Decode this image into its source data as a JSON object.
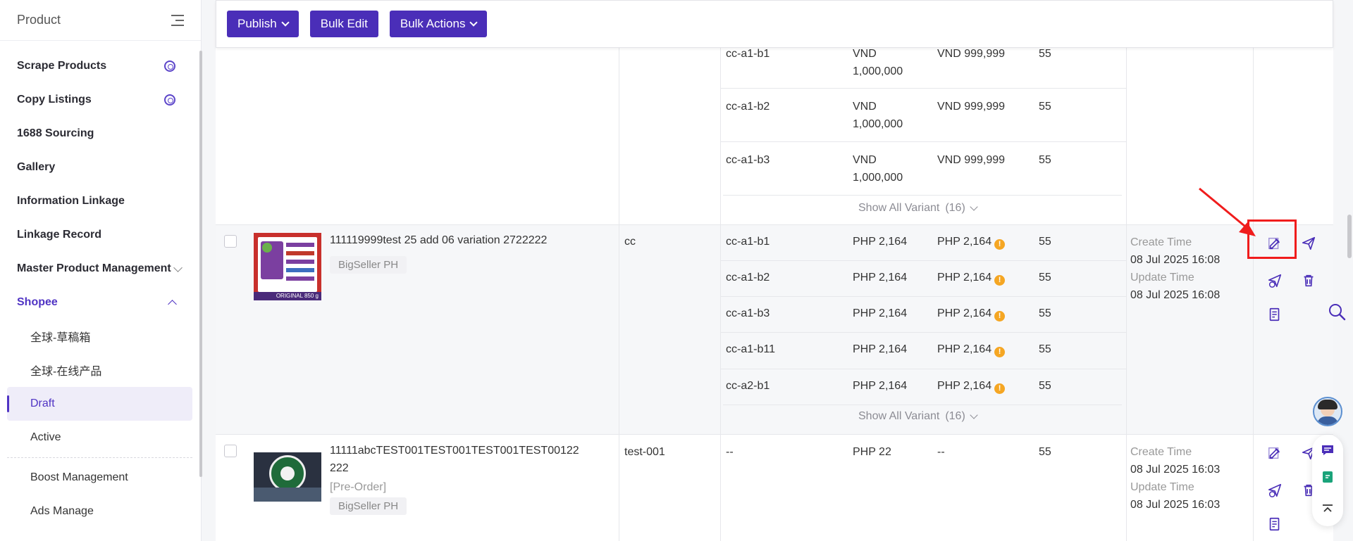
{
  "sidebar": {
    "title": "Product",
    "items": [
      {
        "label": "Scrape Products"
      },
      {
        "label": "Copy Listings"
      },
      {
        "label": "1688 Sourcing"
      },
      {
        "label": "Gallery"
      },
      {
        "label": "Information Linkage"
      },
      {
        "label": "Linkage Record"
      },
      {
        "label": "Master Product Management"
      },
      {
        "label": "Shopee"
      }
    ],
    "sub_items": [
      {
        "label": "全球-草稿箱"
      },
      {
        "label": "全球-在线产品"
      },
      {
        "label": "Draft"
      },
      {
        "label": "Active"
      },
      {
        "label": "Boost Management"
      },
      {
        "label": "Ads Manage"
      }
    ]
  },
  "toolbar": {
    "publish": "Publish",
    "bulk_edit": "Bulk Edit",
    "bulk_actions": "Bulk Actions"
  },
  "prev_product": {
    "variants": [
      {
        "sku": "cc-a1-b1",
        "price1": "VND",
        "price1b": "1,000,000",
        "price2": "VND 999,999",
        "stock": "55"
      },
      {
        "sku": "cc-a1-b2",
        "price1": "VND",
        "price1b": "1,000,000",
        "price2": "VND 999,999",
        "stock": "55"
      },
      {
        "sku": "cc-a1-b3",
        "price1": "VND",
        "price1b": "1,000,000",
        "price2": "VND 999,999",
        "stock": "55"
      }
    ],
    "show_all": "Show All Variant",
    "count": "(16)"
  },
  "product1": {
    "title": "111119999test 25 add 06 variation 2722222",
    "store_tag": "BigSeller PH",
    "parent_sku": "cc",
    "variants": [
      {
        "sku": "cc-a1-b1",
        "price": "PHP 2,164",
        "price2": "PHP 2,164",
        "stock": "55"
      },
      {
        "sku": "cc-a1-b2",
        "price": "PHP 2,164",
        "price2": "PHP 2,164",
        "stock": "55"
      },
      {
        "sku": "cc-a1-b3",
        "price": "PHP 2,164",
        "price2": "PHP 2,164",
        "stock": "55"
      },
      {
        "sku": "cc-a1-b11",
        "price": "PHP 2,164",
        "price2": "PHP 2,164",
        "stock": "55"
      },
      {
        "sku": "cc-a2-b1",
        "price": "PHP 2,164",
        "price2": "PHP 2,164",
        "stock": "55"
      }
    ],
    "warn_glyph": "!",
    "show_all": "Show All Variant",
    "count": "(16)",
    "create_label": "Create Time",
    "create_time": "08 Jul 2025 16:08",
    "update_label": "Update Time",
    "update_time": "08 Jul 2025 16:08",
    "image_banner": "ORIGINAL 850 g"
  },
  "product2": {
    "title_line1": "11111abcTEST001TEST001TEST001TEST00122",
    "title_line2": "222",
    "preorder": "[Pre-Order]",
    "store_tag": "BigSeller PH",
    "parent_sku": "test-001",
    "sku": "--",
    "price": "PHP 22",
    "price2": "--",
    "stock": "55",
    "create_label": "Create Time",
    "create_time": "08 Jul 2025 16:03",
    "update_label": "Update Time",
    "update_time": "08 Jul 2025 16:03"
  },
  "colors": {
    "brand": "#4a2eb8",
    "highlight": "#f01c1c",
    "warning": "#f5a623"
  }
}
